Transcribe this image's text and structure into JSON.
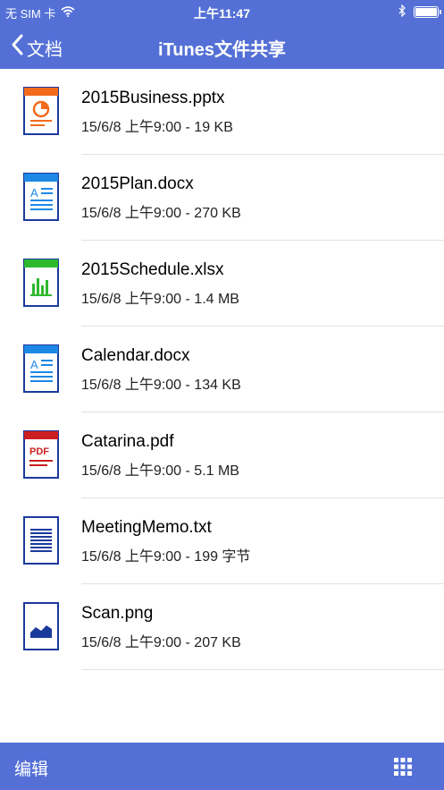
{
  "status_bar": {
    "carrier": "无 SIM 卡",
    "time": "上午11:47",
    "battery_level": 1.0
  },
  "nav": {
    "back_label": "文档",
    "title": "iTunes文件共享"
  },
  "files": [
    {
      "name": "2015Business.pptx",
      "meta": "15/6/8 上午9:00 - 19 KB",
      "type": "pptx",
      "icon": "powerpoint-file-icon",
      "accent": "#f26b1d"
    },
    {
      "name": "2015Plan.docx",
      "meta": "15/6/8 上午9:00 - 270 KB",
      "type": "docx",
      "icon": "word-file-icon",
      "accent": "#1e88e5"
    },
    {
      "name": "2015Schedule.xlsx",
      "meta": "15/6/8 上午9:00 - 1.4 MB",
      "type": "xlsx",
      "icon": "excel-file-icon",
      "accent": "#2eb82e"
    },
    {
      "name": "Calendar.docx",
      "meta": "15/6/8 上午9:00 - 134 KB",
      "type": "docx",
      "icon": "word-file-icon",
      "accent": "#1e88e5"
    },
    {
      "name": "Catarina.pdf",
      "meta": "15/6/8 上午9:00 - 5.1 MB",
      "type": "pdf",
      "icon": "pdf-file-icon",
      "accent": "#cc1f1f",
      "icon_text": "PDF"
    },
    {
      "name": "MeetingMemo.txt",
      "meta": "15/6/8 上午9:00 - 199 字节",
      "type": "txt",
      "icon": "text-file-icon",
      "accent": "#1a3a9c"
    },
    {
      "name": "Scan.png",
      "meta": "15/6/8 上午9:00 - 207 KB",
      "type": "png",
      "icon": "image-file-icon",
      "accent": "#1a3a9c"
    }
  ],
  "toolbar": {
    "edit_label": "编辑",
    "grid_icon": "grid-view-icon"
  },
  "colors": {
    "bar": "#5470d6",
    "file_outline": "#1a3a9c"
  }
}
